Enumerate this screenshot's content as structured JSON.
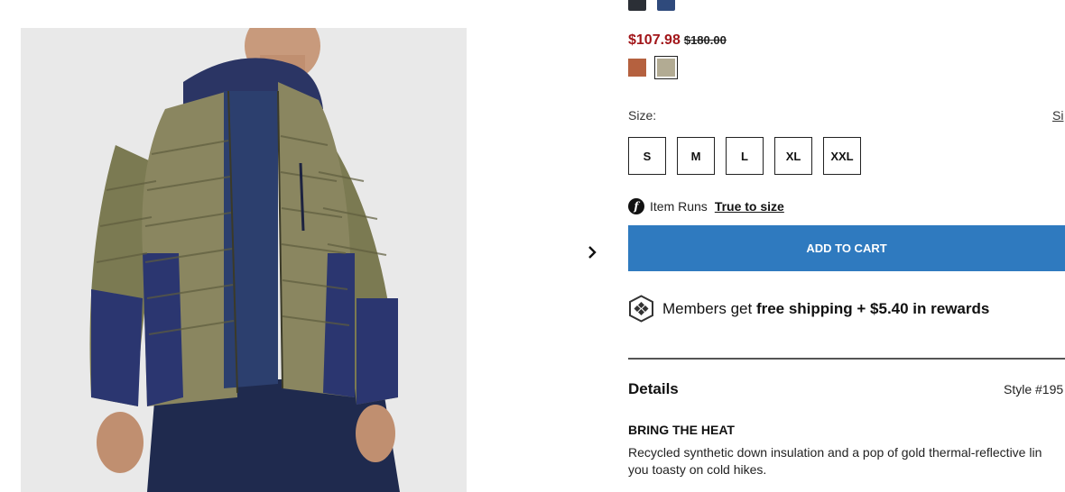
{
  "top_swatches": [
    {
      "name": "black",
      "color": "#2b2f36"
    },
    {
      "name": "navy",
      "color": "#2f4a7c"
    }
  ],
  "price": {
    "sale": "$107.98",
    "original": "$180.00",
    "sale_color": "#a2161a"
  },
  "color_swatches": [
    {
      "name": "rust",
      "color": "#b5613f",
      "selected": false
    },
    {
      "name": "stone-green",
      "color": "#b2ab93",
      "selected": true
    }
  ],
  "size": {
    "label": "Size:",
    "guide_link": "Si",
    "options": [
      "S",
      "M",
      "L",
      "XL",
      "XXL"
    ]
  },
  "fit": {
    "icon": "fit-predictor-icon",
    "icon_glyph": "f",
    "prefix": "Item Runs",
    "link": "True to size"
  },
  "cart": {
    "button_label": "ADD TO CART",
    "button_color": "#2f7abf"
  },
  "members": {
    "icon": "rewards-badge-icon",
    "prefix": "Members get ",
    "bold": "free shipping + $5.40 in rewards"
  },
  "details": {
    "title": "Details",
    "style": "Style #195",
    "heading": "BRING THE HEAT",
    "line1": "Recycled synthetic down insulation and a pop of gold thermal-reflective lin",
    "line2": "you toasty on cold hikes."
  }
}
